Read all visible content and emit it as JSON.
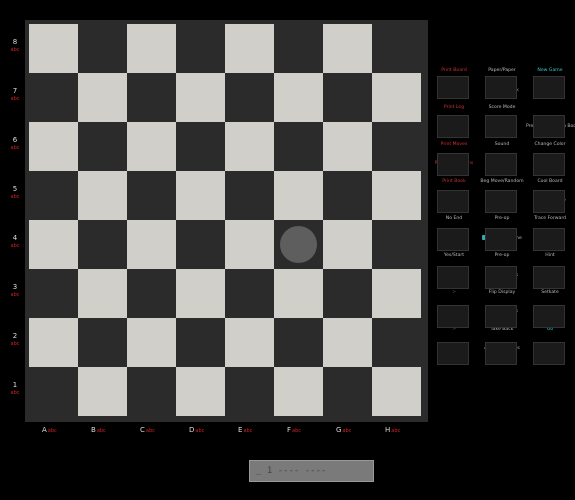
{
  "ranks": [
    "8",
    "7",
    "6",
    "5",
    "4",
    "3",
    "2",
    "1"
  ],
  "rank_sub": "abc",
  "files": [
    "A",
    "B",
    "C",
    "D",
    "E",
    "F",
    "G",
    "H"
  ],
  "file_sub": "abc",
  "board": {
    "piece": {
      "square": "f4",
      "color": "#5e5e5e"
    },
    "light_color": "#d0cfca",
    "dark_color": "#2b2b2b"
  },
  "panel": {
    "rows": [
      [
        "Print Board",
        "Paper/Paper",
        "New Game"
      ],
      [
        "Interface",
        "Game Book",
        "Verify Setup"
      ],
      [
        "Print Log",
        "Score Mode",
        ""
      ],
      [
        "Ask Time",
        "Options",
        "Pre-op Book/Both Books"
      ],
      [
        "Print Moves",
        "Sound",
        "Change Color"
      ],
      [
        "Print Evaluations",
        "Info",
        ""
      ],
      [
        "Print Book",
        "Beg Move/Random",
        "Cool Board"
      ],
      [
        "Store Game",
        "Rewind",
        "Delete Pre-op"
      ],
      [
        "No End",
        "Pre-op",
        "Trace Forward"
      ],
      [
        "End of Game",
        "Restore Game",
        "Auto Play"
      ],
      [
        "Yes/Start",
        "Pre-op",
        "Hint"
      ],
      [
        "Start Game",
        "Tourn Book",
        "New Best"
      ],
      [
        ":-",
        "Flip Display",
        "Setkate"
      ],
      [
        "",
        "Time Controls",
        ""
      ],
      [
        ":-",
        "Take Back",
        "Go"
      ],
      [
        "",
        "Analyze Games",
        ""
      ]
    ]
  },
  "status": {
    "text": "_  1 ---- ----"
  }
}
